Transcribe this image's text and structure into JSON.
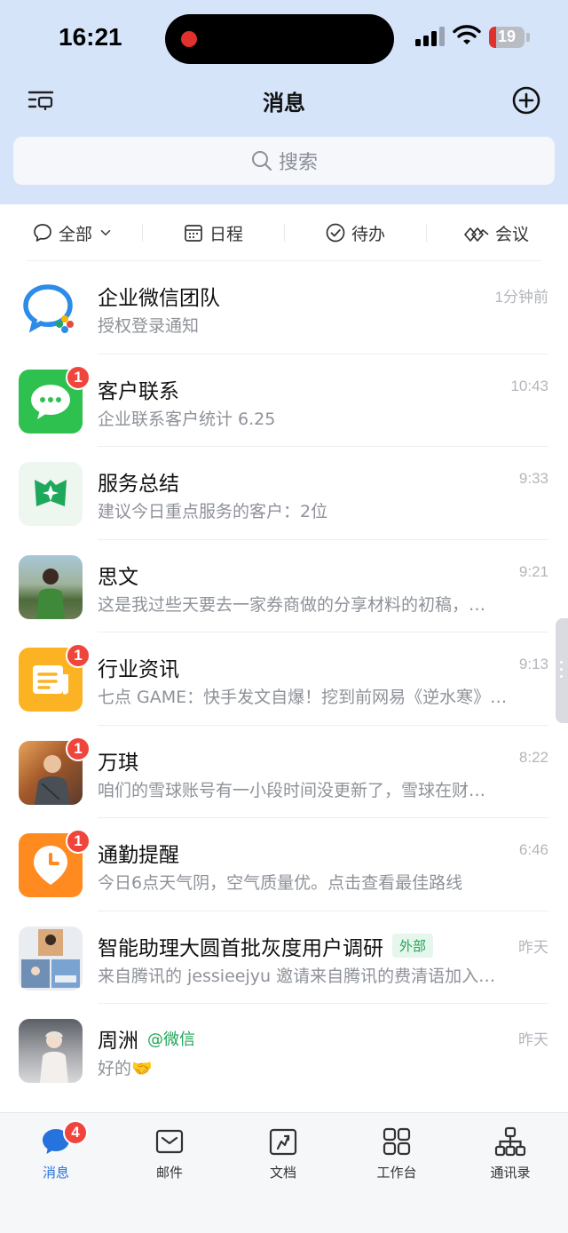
{
  "status_bar": {
    "time": "16:21",
    "battery": "19",
    "battery_level": 0.19
  },
  "header": {
    "title": "消息"
  },
  "search": {
    "placeholder": "搜索"
  },
  "filters": [
    {
      "label": "全部",
      "icon": "chat-bubble-icon"
    },
    {
      "label": "日程",
      "icon": "calendar-icon"
    },
    {
      "label": "待办",
      "icon": "check-circle-icon"
    },
    {
      "label": "会议",
      "icon": "meeting-icon"
    }
  ],
  "messages": [
    {
      "name": "企业微信团队",
      "tag": "",
      "time": "1分钟前",
      "preview": "授权登录通知",
      "badge": "",
      "avatar": "wecom-logo"
    },
    {
      "name": "客户联系",
      "tag": "",
      "time": "10:43",
      "preview": "企业联系客户统计 6.25",
      "badge": "1",
      "avatar": "wechat-green"
    },
    {
      "name": "服务总结",
      "tag": "",
      "time": "9:33",
      "preview": "建议今日重点服务的客户：2位",
      "badge": "",
      "avatar": "service-summary"
    },
    {
      "name": "思文",
      "tag": "",
      "time": "9:21",
      "preview": "这是我过些天要去一家券商做的分享材料的初稿，…",
      "badge": "",
      "avatar": "photo-siwen"
    },
    {
      "name": "行业资讯",
      "tag": "",
      "time": "9:13",
      "preview": "七点 GAME：快手发文自爆！挖到前网易《逆水寒》…",
      "badge": "1",
      "avatar": "news-yellow"
    },
    {
      "name": "万琪",
      "tag": "",
      "time": "8:22",
      "preview": "咱们的雪球账号有一小段时间没更新了，雪球在财…",
      "badge": "1",
      "avatar": "photo-wanqi"
    },
    {
      "name": "通勤提醒",
      "tag": "",
      "time": "6:46",
      "preview": "今日6点天气阴，空气质量优。点击查看最佳路线",
      "badge": "1",
      "avatar": "commute-orange"
    },
    {
      "name": "智能助理大圆首批灰度用户调研",
      "tag": "外部",
      "time": "昨天",
      "preview": "来自腾讯的 jessieejyu 邀请来自腾讯的费清语加入…",
      "badge": "",
      "avatar": "group-photos"
    },
    {
      "name": "周洲",
      "tag": "@微信",
      "time": "昨天",
      "preview": "好的🤝",
      "badge": "",
      "avatar": "photo-zhouzhou"
    }
  ],
  "tabbar": [
    {
      "label": "消息",
      "icon": "message-icon",
      "badge": "4",
      "active": true
    },
    {
      "label": "邮件",
      "icon": "mail-icon",
      "badge": "",
      "active": false
    },
    {
      "label": "文档",
      "icon": "document-icon",
      "badge": "",
      "active": false
    },
    {
      "label": "工作台",
      "icon": "workbench-icon",
      "badge": "",
      "active": false
    },
    {
      "label": "通讯录",
      "icon": "contacts-icon",
      "badge": "",
      "active": false
    }
  ],
  "colors": {
    "header_bg": "#d6e4fa",
    "accent": "#2673dd",
    "badge": "#f0453d",
    "external_tag": "#21a557"
  }
}
